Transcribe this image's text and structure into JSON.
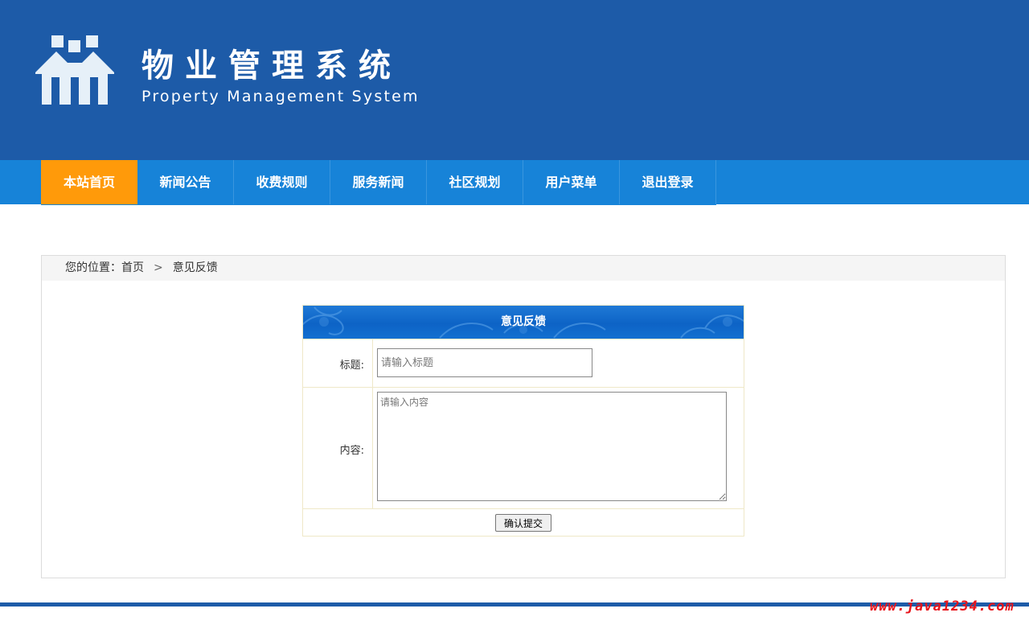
{
  "header": {
    "title_zh": "物业管理系统",
    "title_en": "Property Management System",
    "background_color": "#1d5ba8",
    "logo_icon": "houses-logo-icon"
  },
  "nav": {
    "background_color": "#1783d8",
    "active_color": "#ff9a0a",
    "items": [
      {
        "label": "本站首页",
        "active": true
      },
      {
        "label": "新闻公告",
        "active": false
      },
      {
        "label": "收费规则",
        "active": false
      },
      {
        "label": "服务新闻",
        "active": false
      },
      {
        "label": "社区规划",
        "active": false
      },
      {
        "label": "用户菜单",
        "active": false
      },
      {
        "label": "退出登录",
        "active": false
      }
    ]
  },
  "breadcrumb": {
    "prefix": "您的位置：",
    "home": "首页",
    "separator": ">",
    "current": "意见反馈"
  },
  "form": {
    "title": "意见反馈",
    "title_label": "标题:",
    "title_placeholder": "请输入标题",
    "title_value": "",
    "content_label": "内容:",
    "content_placeholder": "请输入内容",
    "content_value": "",
    "submit_label": "确认提交"
  },
  "footer": {
    "watermark": "www.java1234.com",
    "line_color": "#1d5ba8"
  }
}
